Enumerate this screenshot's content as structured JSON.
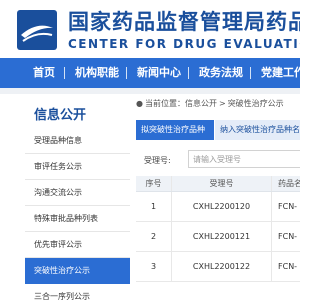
{
  "header": {
    "title_cn": "国家药品监督管理局药品审评中心",
    "title_en": "CENTER FOR DRUG EVALUATION, NMPA",
    "logo_icon": "cde-logo-icon"
  },
  "nav": {
    "items": [
      {
        "label": "首页"
      },
      {
        "label": "机构职能"
      },
      {
        "label": "新闻中心"
      },
      {
        "label": "政务法规"
      },
      {
        "label": "党建工作"
      }
    ]
  },
  "sidebar": {
    "title": "信息公开",
    "items": [
      {
        "label": "受理品种信息"
      },
      {
        "label": "审评任务公示"
      },
      {
        "label": "沟通交流公示"
      },
      {
        "label": "特殊审批品种列表"
      },
      {
        "label": "优先审评公示"
      },
      {
        "label": "突破性治疗公示"
      },
      {
        "label": "三合一序列公示"
      }
    ],
    "active_index": 5
  },
  "breadcrumb": {
    "prefix": "当前位置：",
    "items": [
      "信息公开",
      "突破性治疗公示"
    ],
    "separator": ">"
  },
  "tabs": [
    {
      "label": "拟突破性治疗品种"
    },
    {
      "label": "纳入突破性治疗品种名单"
    }
  ],
  "filter": {
    "label": "受理号:",
    "placeholder": "请输入受理号"
  },
  "table": {
    "columns": [
      "序号",
      "受理号",
      "药品名称"
    ],
    "rows": [
      [
        "1",
        "CXHL2200120",
        "FCN-"
      ],
      [
        "2",
        "CXHL2200121",
        "FCN-"
      ],
      [
        "3",
        "CXHL2200122",
        "FCN-"
      ]
    ]
  },
  "colors": {
    "brand_blue": "#1a4f9c",
    "nav_blue": "#2b6dd3"
  }
}
